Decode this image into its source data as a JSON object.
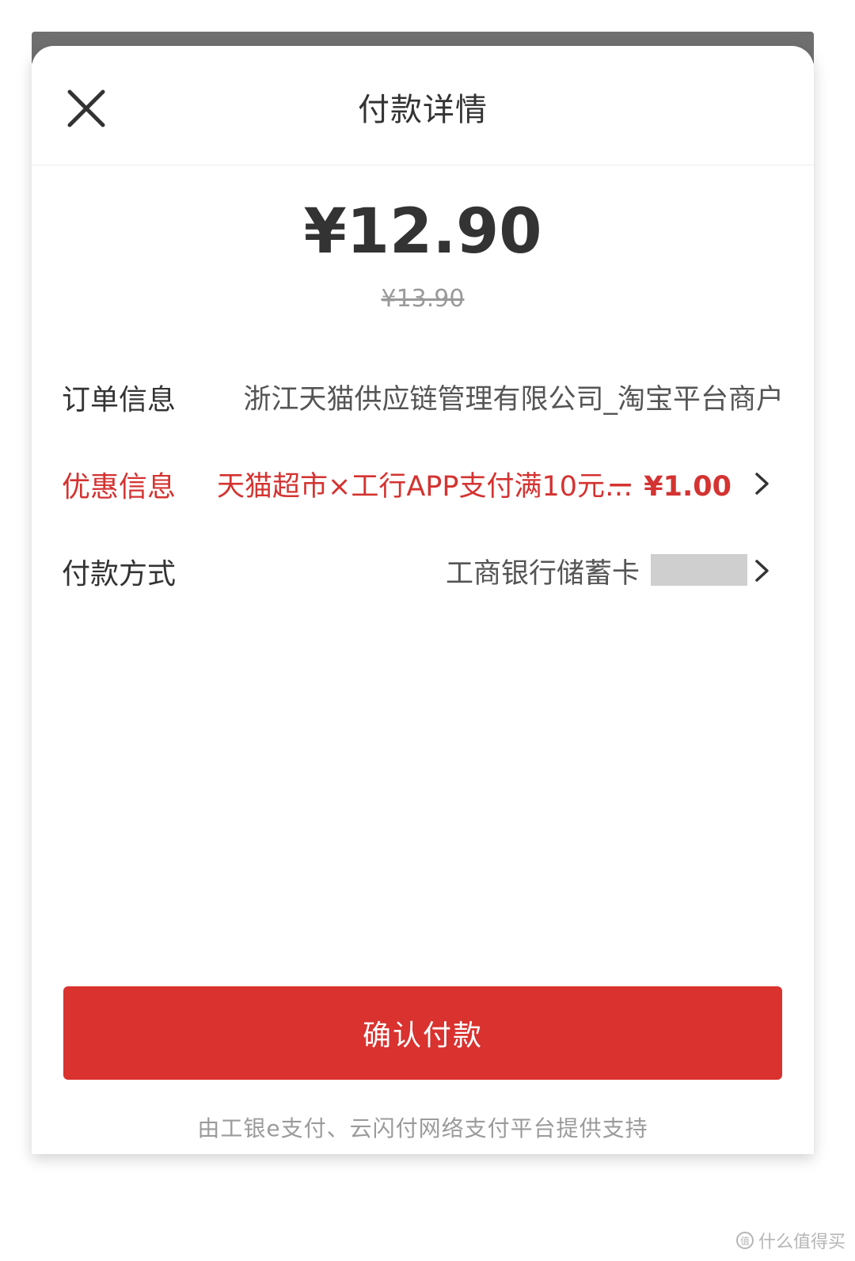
{
  "header": {
    "title": "付款详情"
  },
  "amount": {
    "current": "¥12.90",
    "original": "¥13.90"
  },
  "rows": {
    "order": {
      "label": "订单信息",
      "value": "浙江天猫供应链管理有限公司_淘宝平台商户"
    },
    "promo": {
      "label": "优惠信息",
      "value": "天猫超市×工行APP支付满10元…",
      "discount": "－ ¥1.00"
    },
    "payment": {
      "label": "付款方式",
      "value": "工商银行储蓄卡"
    }
  },
  "confirm_button": {
    "label": "确认付款"
  },
  "footer_note": "由工银e支付、云闪付网络支付平台提供支持",
  "watermark": {
    "icon_text": "值",
    "text": "什么值得买"
  },
  "colors": {
    "accent_red": "#d9322f",
    "promo_red": "#d43331",
    "text_dark": "#333333",
    "text_gray": "#9b9b9b"
  },
  "icons": {
    "close": "close-icon",
    "chevron": "chevron-right-icon"
  }
}
